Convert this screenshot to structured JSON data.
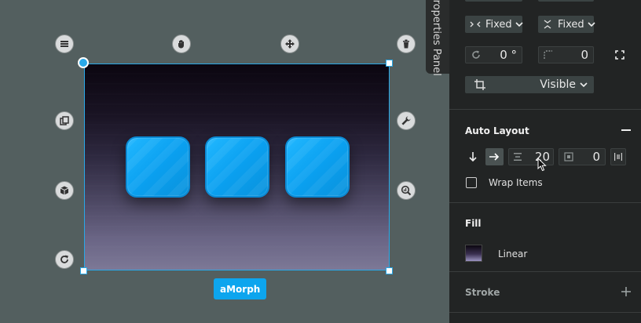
{
  "canvas": {
    "morph_name": "aMorph",
    "halo_icons": [
      "menu-icon",
      "grab-icon",
      "move-icon",
      "delete-icon",
      "duplicate-icon",
      "wrench-icon",
      "cube-icon",
      "inspect-icon",
      "rotate-icon"
    ]
  },
  "panel_tab": {
    "label": "Properties Panel"
  },
  "layout": {
    "width_mode": "Fixed",
    "height_mode": "Fixed",
    "rotation": "0 °",
    "corner_radius": "0",
    "clipping": "Visible"
  },
  "auto_layout": {
    "title": "Auto Layout",
    "spacing": "20",
    "padding": "0",
    "wrap_label": "Wrap Items",
    "direction": "horizontal"
  },
  "fill": {
    "title": "Fill",
    "type": "Linear"
  },
  "stroke": {
    "title": "Stroke"
  },
  "colors": {
    "accent": "#0da5ee",
    "panel_bg": "#222424",
    "canvas_bg": "#535f5f"
  }
}
